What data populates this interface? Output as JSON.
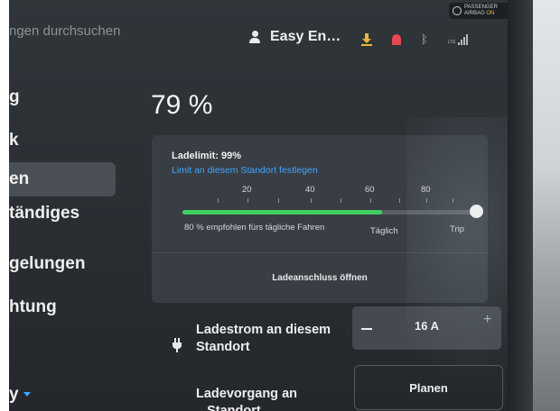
{
  "header": {
    "search_text": "ngen durchsuchen",
    "profile_name": "Easy En…",
    "airbag_line1": "PASSENGER",
    "airbag_line2": "AIRBAG",
    "airbag_status": "ON",
    "signal_label": "LTE",
    "bluetooth_glyph": "ᛒ"
  },
  "sidebar": {
    "items": [
      {
        "label": "g"
      },
      {
        "label": "k"
      },
      {
        "label": "en",
        "active": true
      },
      {
        "label": "tändiges"
      },
      {
        "label": "gelungen"
      },
      {
        "label": "htung"
      },
      {
        "label": "y"
      }
    ]
  },
  "charging": {
    "battery_percent": "79 %",
    "limit_label": "Ladelimit: 99%",
    "limit_link": "Limit an diesem Standort festlegen",
    "ticks": [
      "20",
      "40",
      "60",
      "80"
    ],
    "charge_limit_percent": 99,
    "recommendation": "80 % empfohlen fürs tägliche Fahren",
    "daily_label": "Täglich",
    "trip_label": "Trip",
    "port_button": "Ladeanschluss öffnen",
    "current_label": "Ladestrom an diesem Standort",
    "current_value": "16 A",
    "minus_symbol": "−",
    "plus_symbol": "+",
    "session_label": "Ladevorgang an ...Standort",
    "plan_button": "Planen"
  },
  "colors": {
    "accent_blue": "#3ea5ff",
    "charge_green": "#3ecf60",
    "warning_yellow": "#e9b53c",
    "alert_red": "#e5484d"
  }
}
